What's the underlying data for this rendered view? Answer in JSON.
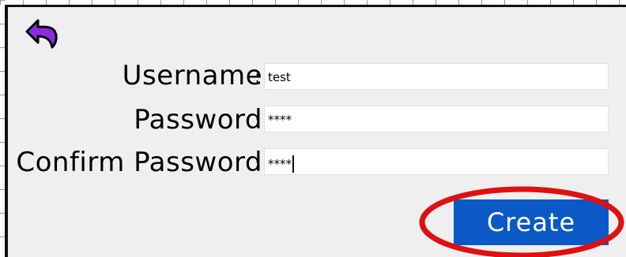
{
  "form": {
    "back_icon": "back-arrow-icon",
    "username_label": "Username",
    "password_label": "Password",
    "confirm_label": "Confirm Password",
    "colon": ":",
    "username_value": "test",
    "password_value": "****",
    "confirm_value": "****",
    "create_label": "Create"
  },
  "colors": {
    "accent": "#0a59c6",
    "back_icon": "#8a2be2",
    "highlight": "#e01010",
    "panel_bg": "#efefef"
  }
}
